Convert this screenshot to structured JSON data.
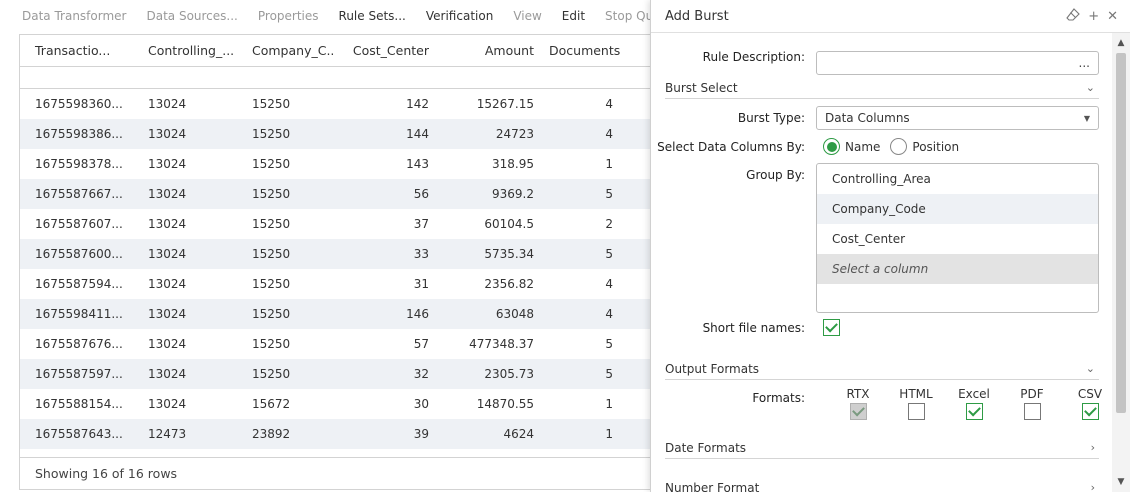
{
  "menu": {
    "items": [
      {
        "label": "Data Transformer",
        "disabled": true
      },
      {
        "label": "Data Sources...",
        "disabled": true
      },
      {
        "label": "Properties",
        "disabled": true
      },
      {
        "label": "Rule Sets...",
        "disabled": false
      },
      {
        "label": "Verification",
        "disabled": false
      },
      {
        "label": "View",
        "disabled": true
      },
      {
        "label": "Edit",
        "disabled": false
      },
      {
        "label": "Stop QuickEd",
        "disabled": true
      }
    ]
  },
  "grid": {
    "columns": [
      "Transactio...",
      "Controlling_...",
      "Company_C...",
      "Cost_Center",
      "Amount",
      "Documents"
    ],
    "rows": [
      [
        "1675598360...",
        "13024",
        "15250",
        "142",
        "15267.15",
        "4"
      ],
      [
        "1675598386...",
        "13024",
        "15250",
        "144",
        "24723",
        "4"
      ],
      [
        "1675598378...",
        "13024",
        "15250",
        "143",
        "318.95",
        "1"
      ],
      [
        "1675587667...",
        "13024",
        "15250",
        "56",
        "9369.2",
        "5"
      ],
      [
        "1675587607...",
        "13024",
        "15250",
        "37",
        "60104.5",
        "2"
      ],
      [
        "1675587600...",
        "13024",
        "15250",
        "33",
        "5735.34",
        "5"
      ],
      [
        "1675587594...",
        "13024",
        "15250",
        "31",
        "2356.82",
        "4"
      ],
      [
        "1675598411...",
        "13024",
        "15250",
        "146",
        "63048",
        "4"
      ],
      [
        "1675587676...",
        "13024",
        "15250",
        "57",
        "477348.37",
        "5"
      ],
      [
        "1675587597...",
        "13024",
        "15250",
        "32",
        "2305.73",
        "5"
      ],
      [
        "1675588154...",
        "13024",
        "15672",
        "30",
        "14870.55",
        "1"
      ],
      [
        "1675587643...",
        "12473",
        "23892",
        "39",
        "4624",
        "1"
      ]
    ],
    "footer": "Showing 16 of 16 rows"
  },
  "panel": {
    "title": "Add Burst",
    "rule_description_label": "Rule Description:",
    "rule_description_value": "",
    "rule_description_button": "...",
    "burst_select_section": "Burst Select",
    "burst_type_label": "Burst Type:",
    "burst_type_value": "Data Columns",
    "select_by_label": "Select Data Columns By:",
    "select_by_options": [
      "Name",
      "Position"
    ],
    "select_by_selected": "Name",
    "group_by_label": "Group By:",
    "group_by_items": [
      "Controlling_Area",
      "Company_Code",
      "Cost_Center"
    ],
    "group_by_placeholder": "Select a column",
    "short_names_label": "Short file names:",
    "short_names_checked": true,
    "output_formats_section": "Output Formats",
    "formats_label": "Formats:",
    "formats": [
      {
        "name": "RTX",
        "checked": true,
        "disabled": true
      },
      {
        "name": "HTML",
        "checked": false,
        "disabled": false
      },
      {
        "name": "Excel",
        "checked": true,
        "disabled": false
      },
      {
        "name": "PDF",
        "checked": false,
        "disabled": false
      },
      {
        "name": "CSV",
        "checked": true,
        "disabled": false
      }
    ],
    "date_formats_section": "Date Formats",
    "number_format_section": "Number Format"
  },
  "colors": {
    "accent_green": "#2e9b45",
    "row_stripe": "#eef1f5"
  }
}
